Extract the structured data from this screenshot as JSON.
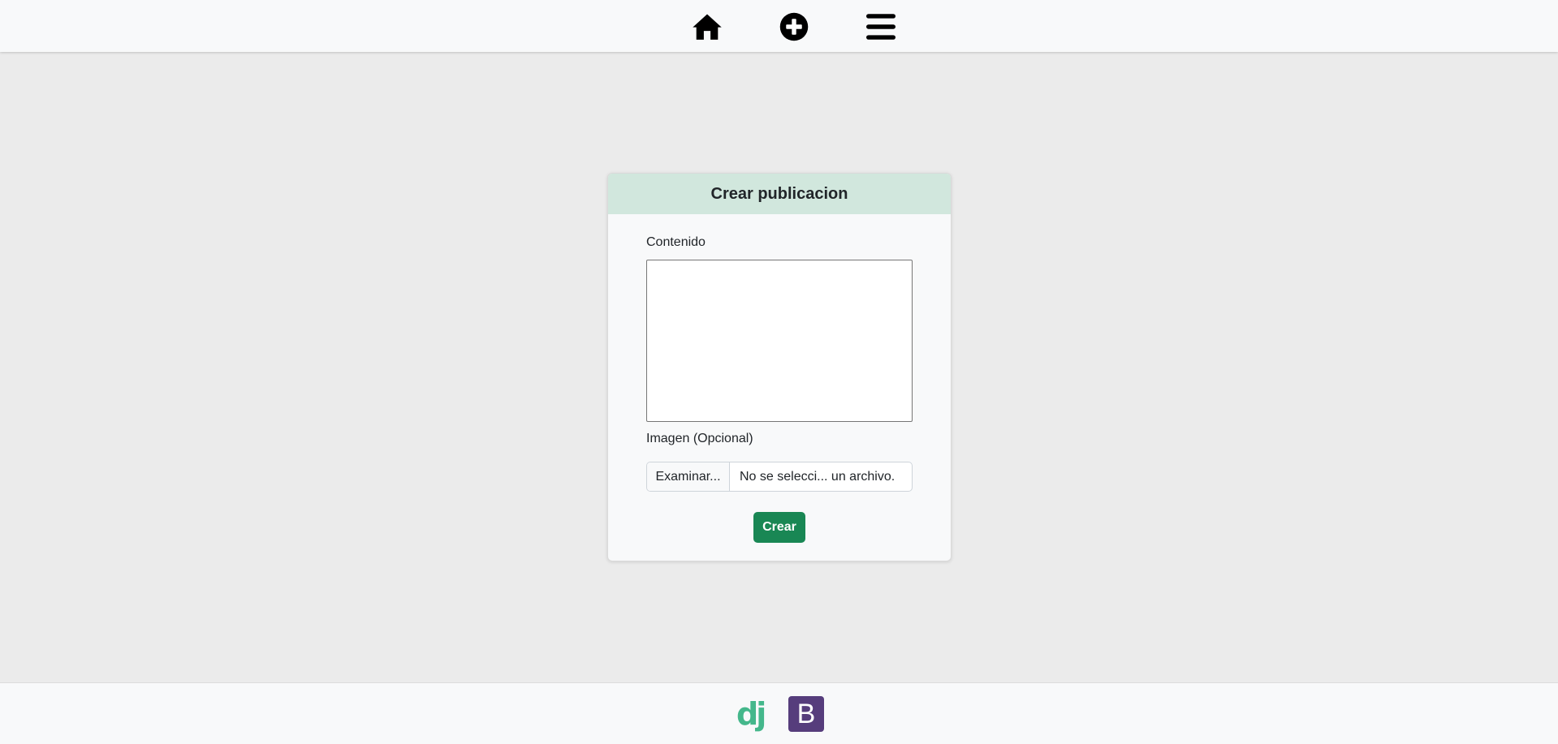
{
  "navbar": {
    "icons": [
      "home-icon",
      "plus-circle-icon",
      "menu-icon"
    ]
  },
  "form": {
    "title": "Crear publicacion",
    "content_label": "Contenido",
    "content_value": "",
    "image_label": "Imagen (Opcional)",
    "file_button_label": "Examinar...",
    "file_status": "No se selecci... un archivo.",
    "submit_label": "Crear",
    "header_color": "#d1e7dd",
    "submit_color": "#198754"
  },
  "footer": {
    "logos": [
      "django-logo",
      "bootstrap-logo"
    ],
    "django_text": "dj",
    "bootstrap_text": "B"
  }
}
